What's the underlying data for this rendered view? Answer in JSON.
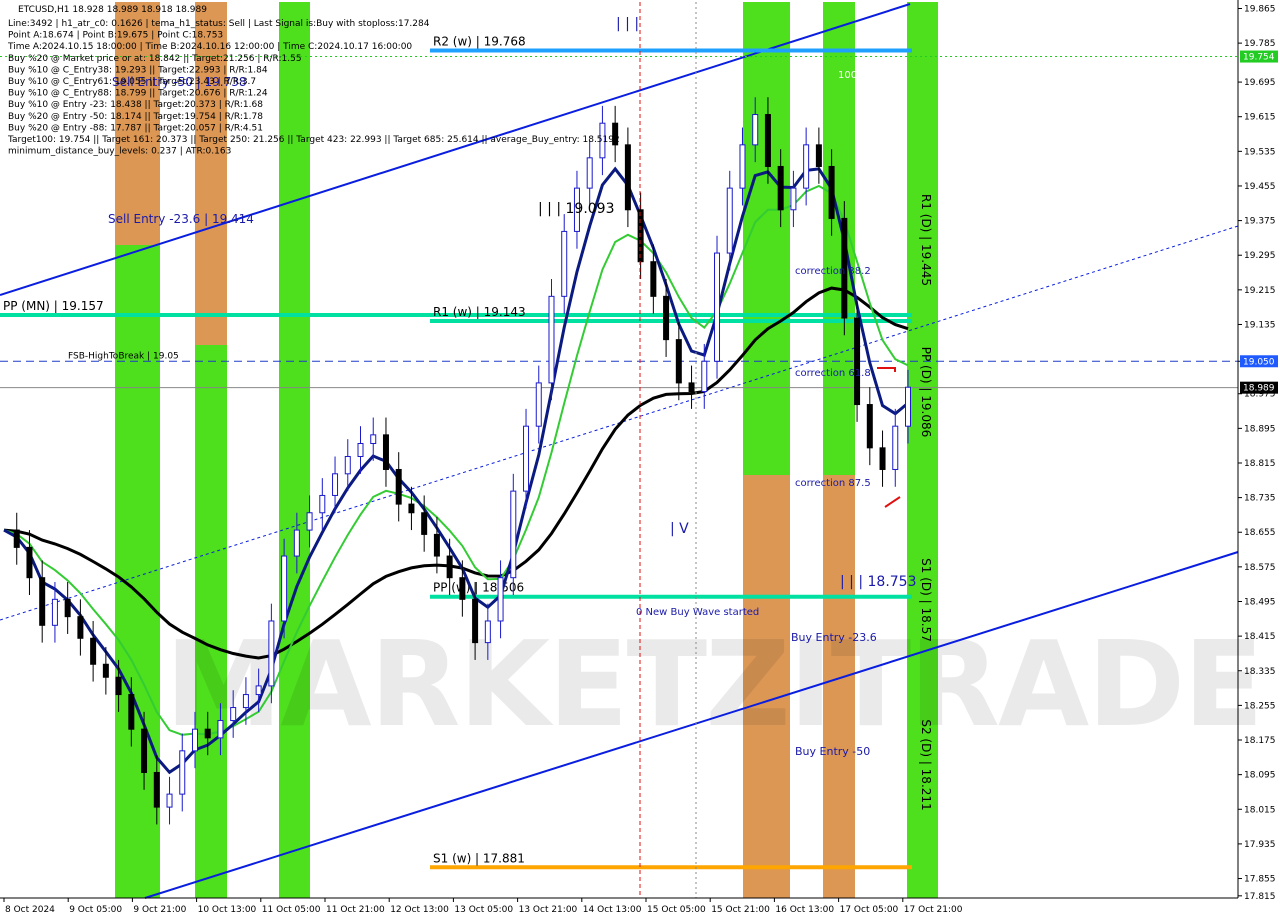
{
  "chart_data": {
    "type": "line",
    "symbol": "ETCUSD,H1",
    "ohlc_header": "ETCUSD,H1  18.928 18.989 18.918 18.989",
    "info_lines": [
      "Line:3492 | h1_atr_c0: 0.1626 | tema_h1_status: Sell | Last Signal is:Buy with stoploss:17.284",
      "Point A:18.674 | Point B:19.675 | Point C:18.753",
      "Time A:2024.10.15 18:00:00 | Time B:2024.10.16 12:00:00 | Time C:2024.10.17 16:00:00",
      "Buy %20 @ Market price or at: 18.842 || Target:21.256 | R/R:1.55",
      "Buy %10 @ C_Entry38: 19.293 || Target:22.993 | R/R:1.84",
      "Buy %10 @ C_Entry61: 19.055 || Target:23.43 | R/R:3.7",
      "Buy %10 @ C_Entry88: 18.799 || Target:20.676 | R/R:1.24",
      "Buy %10 @ Entry -23: 18.438 || Target:20.373 | R/R:1.68",
      "Buy %20 @ Entry -50: 18.174 || Target:19.754 | R/R:1.78",
      "Buy %20 @ Entry -88: 17.787 || Target:20.057 | R/R:4.51",
      "Target100: 19.754 || Target 161: 20.373 || Target 250: 21.256 || Target 423: 22.993 || Target 685: 25.614 || average_Buy_entry: 18.5192",
      "minimum_distance_buy_levels: 0.237 | ATR:0.163"
    ],
    "x_ticks": [
      "8 Oct 2024",
      "9 Oct 05:00",
      "9 Oct 21:00",
      "10 Oct 13:00",
      "11 Oct 05:00",
      "11 Oct 21:00",
      "12 Oct 13:00",
      "13 Oct 05:00",
      "13 Oct 21:00",
      "14 Oct 13:00",
      "15 Oct 05:00",
      "15 Oct 21:00",
      "16 Oct 13:00",
      "17 Oct 05:00",
      "17 Oct 21:00"
    ],
    "y_ticks": [
      "19.865",
      "19.825",
      "19.785",
      "19.745",
      "19.695",
      "19.655",
      "19.615",
      "19.575",
      "19.535",
      "19.495",
      "19.455",
      "19.415",
      "19.375",
      "19.335",
      "19.295",
      "19.255",
      "19.215",
      "19.175",
      "19.135",
      "19.095",
      "19.055",
      "19.015",
      "18.975",
      "18.935",
      "18.895",
      "18.855",
      "18.815",
      "18.775",
      "18.735",
      "18.695",
      "18.655",
      "18.615",
      "18.575",
      "18.535",
      "18.495",
      "18.455",
      "18.415",
      "18.375",
      "18.335",
      "18.295",
      "18.255",
      "18.215",
      "18.175",
      "18.135",
      "18.095",
      "18.055",
      "18.015",
      "17.975",
      "17.935",
      "17.895",
      "17.855",
      "17.815"
    ],
    "y_ticks_shown": [
      "19.865",
      "19.785",
      "19.695",
      "19.615",
      "19.535",
      "19.455",
      "19.375",
      "19.295",
      "19.215",
      "19.135",
      "19.050",
      "18.975",
      "18.895",
      "18.815",
      "18.735",
      "18.655",
      "18.575",
      "18.495",
      "18.415",
      "18.335",
      "18.255",
      "18.175",
      "18.095",
      "18.015",
      "17.935",
      "17.855",
      "17.815"
    ],
    "ylim": [
      17.81,
      19.88
    ],
    "price_tags": [
      {
        "value": 19.754,
        "label": "19.754",
        "color": "#22cc22"
      },
      {
        "value": 19.05,
        "label": "19.050",
        "color": "#1e5aff"
      },
      {
        "value": 18.989,
        "label": "18.989",
        "color": "#000000"
      }
    ],
    "levels": [
      {
        "label": "R2 (w) | 19.768",
        "value": 19.768,
        "color": "#1ea0ff",
        "x_from": 0.336,
        "x_to": 0.711
      },
      {
        "label": "PP (MN) | 19.157",
        "value": 19.157,
        "color": "#00e0a0",
        "x_from": 0.0,
        "x_to": 0.711
      },
      {
        "label": "R1 (w) | 19.143",
        "value": 19.143,
        "color": "#00e0a0",
        "x_from": 0.336,
        "x_to": 0.711
      },
      {
        "label": "PP (w) | 18.506",
        "value": 18.506,
        "color": "#00e0a0",
        "x_from": 0.336,
        "x_to": 0.711
      },
      {
        "label": "S1 (w) | 17.881",
        "value": 17.881,
        "color": "#ffa500",
        "x_from": 0.336,
        "x_to": 0.711
      }
    ],
    "vertical_labels": [
      "R1 (D) | 19.445",
      "PP (D) | 19.086",
      "S1 (D) | 18.57",
      "S2 (D) | 18.211"
    ],
    "annotations": [
      "Sell Entry -23.6 | 19.414",
      "Sell Entry -50 | 19.738",
      "FSB-HighToBreak | 19.05",
      "| | | 19.093",
      "correction 38.2",
      "correction 61.8",
      "correction 87.5",
      "| | | 18.753",
      "0 New Buy Wave started",
      "Buy Entry -23.6",
      "Buy Entry -50",
      "| V",
      "| | |",
      "100"
    ],
    "watermark": "MARKETZITRADE",
    "close_series": [
      18.66,
      18.62,
      18.55,
      18.44,
      18.5,
      18.46,
      18.41,
      18.35,
      18.32,
      18.28,
      18.2,
      18.1,
      18.02,
      18.05,
      18.15,
      18.2,
      18.18,
      18.22,
      18.25,
      18.28,
      18.3,
      18.45,
      18.6,
      18.66,
      18.7,
      18.74,
      18.79,
      18.83,
      18.86,
      18.88,
      18.8,
      18.72,
      18.7,
      18.65,
      18.6,
      18.55,
      18.5,
      18.4,
      18.45,
      18.55,
      18.75,
      18.9,
      19.0,
      19.2,
      19.35,
      19.45,
      19.52,
      19.6,
      19.55,
      19.4,
      19.28,
      19.2,
      19.1,
      19.0,
      18.98,
      19.05,
      19.3,
      19.45,
      19.55,
      19.62,
      19.5,
      19.4,
      19.45,
      19.55,
      19.5,
      19.38,
      19.15,
      18.95,
      18.85,
      18.8,
      18.9,
      18.99
    ],
    "colors": {
      "green_zone": "#44dd11",
      "orange_zone": "#e8905a",
      "tema_blue": "#0a1a80",
      "ma_green": "#33cc33",
      "ma_black": "#000000",
      "channel_blue": "#0a1ee0",
      "bull_candle": "#1a1acc",
      "bear_candle": "#000000"
    }
  }
}
